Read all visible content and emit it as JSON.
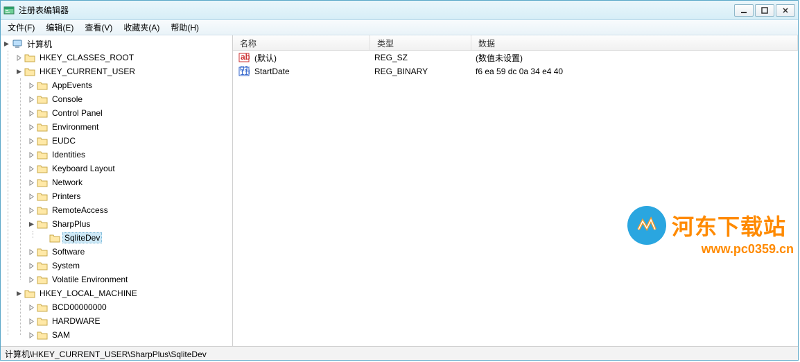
{
  "window": {
    "title": "注册表编辑器"
  },
  "menus": [
    {
      "label": "文件(F)"
    },
    {
      "label": "编辑(E)"
    },
    {
      "label": "查看(V)"
    },
    {
      "label": "收藏夹(A)"
    },
    {
      "label": "帮助(H)"
    }
  ],
  "tree": {
    "root": "计算机",
    "hkcr": "HKEY_CLASSES_ROOT",
    "hkcu": "HKEY_CURRENT_USER",
    "hklm": "HKEY_LOCAL_MACHINE",
    "hkcu_children": [
      "AppEvents",
      "Console",
      "Control Panel",
      "Environment",
      "EUDC",
      "Identities",
      "Keyboard Layout",
      "Network",
      "Printers",
      "RemoteAccess",
      "SharpPlus",
      "Software",
      "System",
      "Volatile Environment"
    ],
    "sharpplus_child": "SqliteDev",
    "hklm_children": [
      "BCD00000000",
      "HARDWARE",
      "SAM"
    ]
  },
  "list": {
    "columns": {
      "name": "名称",
      "type": "类型",
      "data": "数据"
    },
    "rows": [
      {
        "icon": "ab",
        "name": "(默认)",
        "type": "REG_SZ",
        "data": "(数值未设置)"
      },
      {
        "icon": "bin",
        "name": "StartDate",
        "type": "REG_BINARY",
        "data": "f6 ea 59 dc 0a 34 e4 40"
      }
    ]
  },
  "statusbar": {
    "path": "计算机\\HKEY_CURRENT_USER\\SharpPlus\\SqliteDev"
  },
  "watermark": {
    "text": "河东下载站",
    "url": "www.pc0359.cn"
  }
}
